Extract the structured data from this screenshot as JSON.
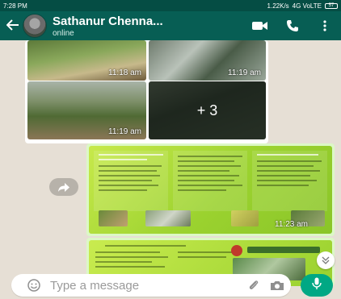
{
  "statusbar": {
    "time": "7:28 PM",
    "info": "1.22K/s",
    "network": "4G VoLTE",
    "battery": "57"
  },
  "header": {
    "contact_name": "Sathanur Chenna...",
    "contact_status": "online",
    "icons": [
      "back-arrow-icon",
      "video-call-icon",
      "call-icon",
      "more-icon"
    ]
  },
  "messages": {
    "photos": {
      "time_1": "11:18 am",
      "time_2": "11:19 am",
      "time_3": "11:19 am",
      "more_count": "+ 3"
    },
    "document": {
      "time": "11:23 am"
    }
  },
  "compose": {
    "placeholder": "Type a message",
    "icons": [
      "emoji-icon",
      "attach-icon",
      "camera-icon",
      "mic-icon"
    ]
  },
  "colors": {
    "header": "#075e54",
    "outgoing_bubble": "#dcf8c6",
    "mic_button": "#00a884"
  }
}
